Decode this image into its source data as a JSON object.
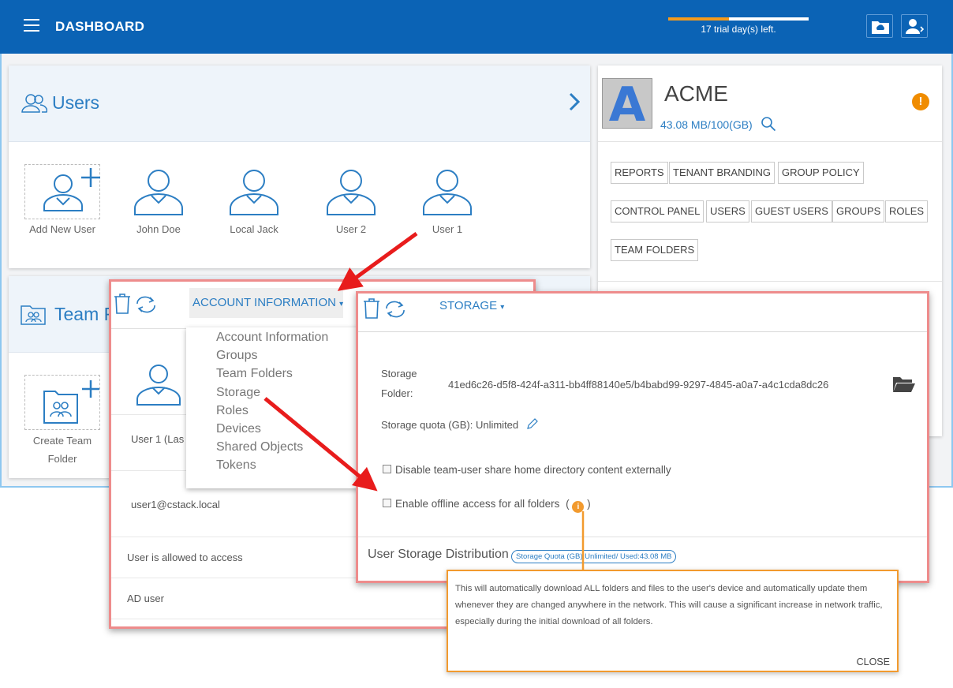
{
  "header": {
    "title": "DASHBOARD",
    "trial_text": "17 trial day(s) left.",
    "trial_progress": 0.43,
    "colors": {
      "bar": "#0b63b5",
      "progress": "#f59a1b"
    }
  },
  "users_card": {
    "title": "Users",
    "tiles": [
      {
        "label": "Add New User"
      },
      {
        "label": "John Doe"
      },
      {
        "label": "Local Jack"
      },
      {
        "label": "User 2"
      },
      {
        "label": "User 1"
      }
    ]
  },
  "team_card": {
    "title": "Team F",
    "tile_label_line1": "Create Team",
    "tile_label_line2": "Folder"
  },
  "tenant": {
    "logo_letter": "A",
    "name": "ACME",
    "quota": "43.08 MB/100(GB)",
    "tags": [
      "REPORTS",
      "TENANT BRANDING",
      "GROUP POLICY",
      "CONTROL PANEL",
      "USERS",
      "GUEST USERS",
      "GROUPS",
      "ROLES",
      "TEAM FOLDERS"
    ]
  },
  "account_dialog": {
    "menu_label": "ACCOUNT INFORMATION",
    "user_name": "User 1  (Las",
    "email": "user1@cstack.local",
    "access_text": "User is allowed to access",
    "ad_text": "AD user",
    "dropdown_items": [
      "Account Information",
      "Groups",
      "Team Folders",
      "Storage",
      "Roles",
      "Devices",
      "Shared Objects",
      "Tokens"
    ]
  },
  "storage_dialog": {
    "menu_label": "STORAGE",
    "folder_label_1": "Storage",
    "folder_label_2": "Folder:",
    "folder_path": "41ed6c26-d5f8-424f-a311-bb4ff88140e5/b4babd99-9297-4845-a0a7-a4c1cda8dc26",
    "quota_text": "Storage quota (GB): Unlimited",
    "checkbox1": "Disable team-user share home directory content externally",
    "checkbox2": "Enable offline access for all folders",
    "distribution_title": "User Storage Distribution",
    "distribution_badge": "Storage Quota (GB):Unlimited/ Used:43.08 MB"
  },
  "tooltip": {
    "text": "This will automatically download ALL folders and files to the user's device and automatically update them whenever they are changed anywhere in the network. This will cause a significant increase in network traffic, especially during the initial download of all folders.",
    "close": "CLOSE"
  }
}
